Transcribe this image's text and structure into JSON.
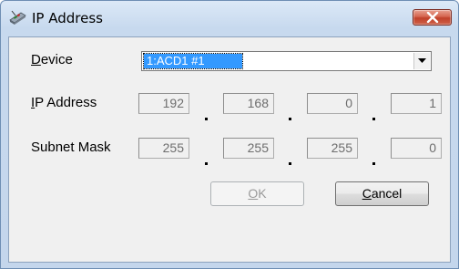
{
  "window": {
    "title": "IP Address"
  },
  "device": {
    "label_first": "D",
    "label_rest": "evice",
    "selected": "1:ACD1 #1"
  },
  "ip_address": {
    "label_first": "I",
    "label_rest": "P Address",
    "octets": [
      "192",
      "168",
      "0",
      "1"
    ]
  },
  "subnet_mask": {
    "label": "Subnet Mask",
    "octets": [
      "255",
      "255",
      "255",
      "0"
    ]
  },
  "buttons": {
    "ok_first": "O",
    "ok_rest": "K",
    "ok_enabled": false,
    "cancel_first": "C",
    "cancel_rest": "ancel"
  },
  "icons": {
    "app": "network-card-icon",
    "close": "close-icon",
    "dropdown": "chevron-down-icon"
  }
}
